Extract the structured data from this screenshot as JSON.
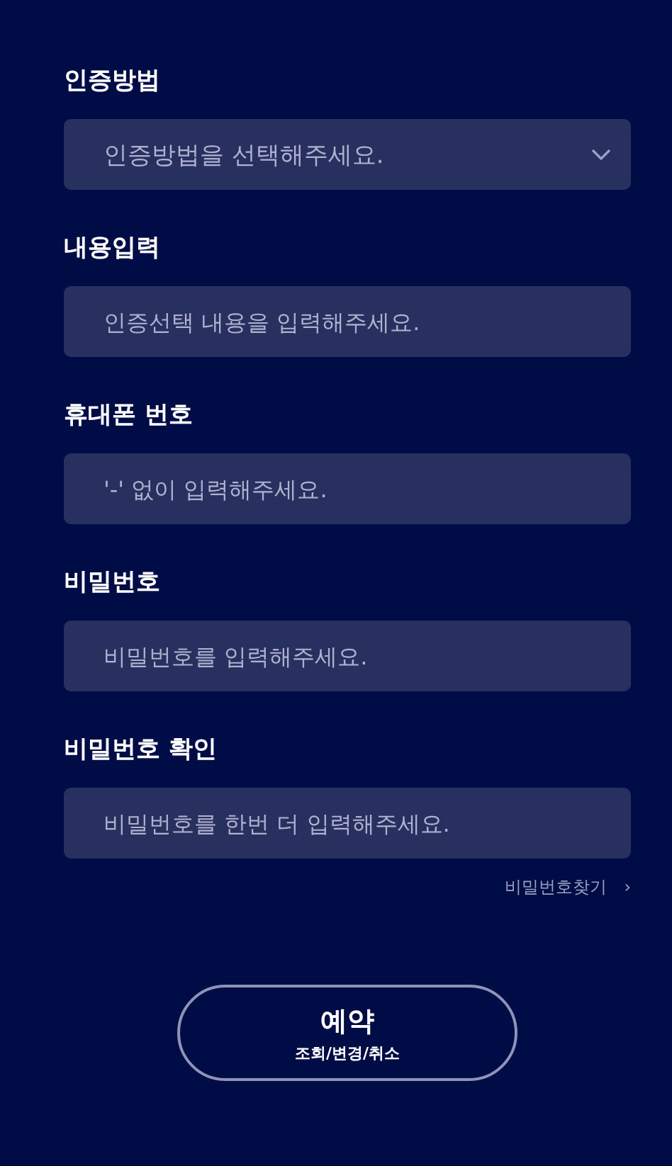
{
  "fields": [
    {
      "label": "인증방법",
      "kind": "select",
      "placeholder": "인증방법을 선택해주세요."
    },
    {
      "label": "내용입력",
      "kind": "text",
      "placeholder": "인증선택 내용을 입력해주세요."
    },
    {
      "label": "휴대폰 번호",
      "kind": "text",
      "placeholder": "'-' 없이 입력해주세요."
    },
    {
      "label": "비밀번호",
      "kind": "text",
      "placeholder": "비밀번호를 입력해주세요."
    },
    {
      "label": "비밀번호 확인",
      "kind": "text",
      "placeholder": "비밀번호를 한번 더 입력해주세요."
    }
  ],
  "find_password_link": {
    "label": "비밀번호찾기",
    "arrow": "›"
  },
  "reservation_button": {
    "title": "예약",
    "subtitle": "조회/변경/취소"
  }
}
